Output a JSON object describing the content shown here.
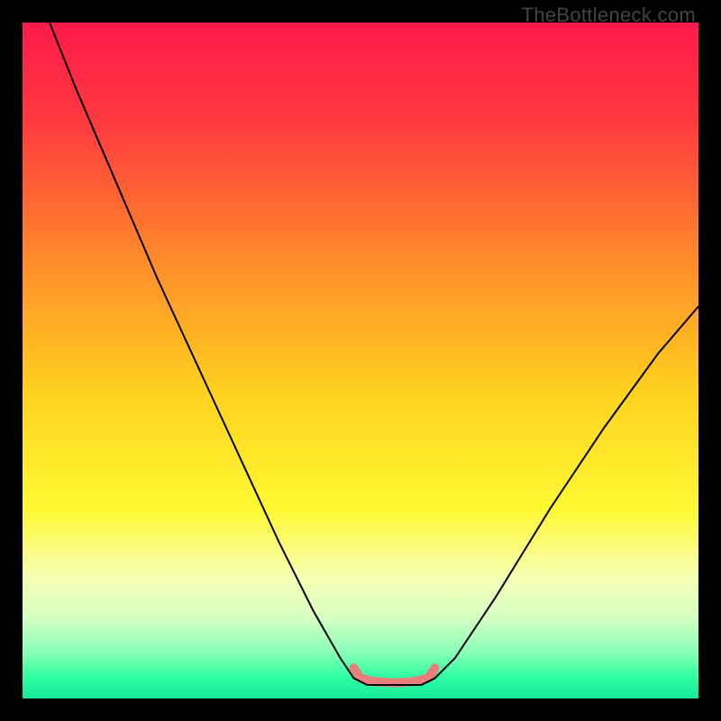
{
  "watermark": "TheBottleneck.com",
  "chart_data": {
    "type": "line",
    "title": "",
    "xlabel": "",
    "ylabel": "",
    "xlim": [
      0,
      100
    ],
    "ylim": [
      0,
      100
    ],
    "gradient_stops": [
      {
        "offset": 0.0,
        "color": "#ff1a4b"
      },
      {
        "offset": 0.15,
        "color": "#ff3a3f"
      },
      {
        "offset": 0.35,
        "color": "#ff8a2a"
      },
      {
        "offset": 0.55,
        "color": "#ffd21f"
      },
      {
        "offset": 0.72,
        "color": "#fff833"
      },
      {
        "offset": 0.82,
        "color": "#f6ffb3"
      },
      {
        "offset": 0.88,
        "color": "#d6ffc2"
      },
      {
        "offset": 0.93,
        "color": "#8cffb8"
      },
      {
        "offset": 0.97,
        "color": "#2dfda0"
      },
      {
        "offset": 1.0,
        "color": "#16e89a"
      }
    ],
    "series": [
      {
        "name": "bottleneck-curve",
        "color": "#000000",
        "stroke_width": 2,
        "points": [
          {
            "x": 4,
            "y": 100
          },
          {
            "x": 8,
            "y": 90
          },
          {
            "x": 14,
            "y": 76
          },
          {
            "x": 20,
            "y": 62
          },
          {
            "x": 26,
            "y": 49
          },
          {
            "x": 32,
            "y": 36
          },
          {
            "x": 38,
            "y": 23
          },
          {
            "x": 43,
            "y": 13
          },
          {
            "x": 47,
            "y": 6
          },
          {
            "x": 49,
            "y": 3
          },
          {
            "x": 51,
            "y": 2
          },
          {
            "x": 55,
            "y": 2
          },
          {
            "x": 59,
            "y": 2
          },
          {
            "x": 61,
            "y": 3
          },
          {
            "x": 64,
            "y": 6
          },
          {
            "x": 70,
            "y": 15
          },
          {
            "x": 78,
            "y": 28
          },
          {
            "x": 86,
            "y": 40
          },
          {
            "x": 94,
            "y": 51
          },
          {
            "x": 100,
            "y": 58
          }
        ]
      },
      {
        "name": "optimal-band",
        "color": "#e77f7d",
        "stroke_width": 10,
        "linecap": "round",
        "points": [
          {
            "x": 49,
            "y": 4.5
          },
          {
            "x": 50,
            "y": 3
          },
          {
            "x": 52,
            "y": 2.5
          },
          {
            "x": 55,
            "y": 2.3
          },
          {
            "x": 58,
            "y": 2.5
          },
          {
            "x": 60,
            "y": 3
          },
          {
            "x": 61,
            "y": 4.5
          }
        ]
      }
    ]
  }
}
